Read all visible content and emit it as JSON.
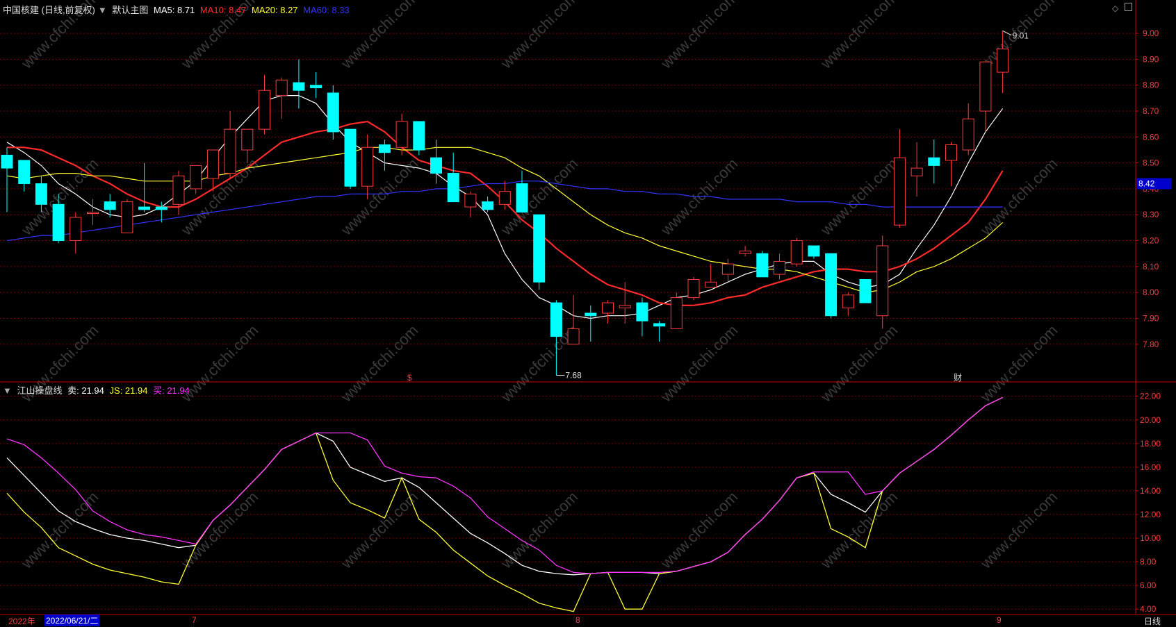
{
  "header_main": {
    "stock": "中国核建 (日线,前复权)",
    "template": "默认主图",
    "ma5": {
      "label": "MA5: 8.71",
      "color": "#ffffff"
    },
    "ma10": {
      "label": "MA10: 8.47",
      "color": "#ff2a2a"
    },
    "ma20": {
      "label": "MA20: 8.27",
      "color": "#ffff33"
    },
    "ma60": {
      "label": "MA60: 8.33",
      "color": "#3333ff"
    }
  },
  "header_sub": {
    "indicator": "江山操盘线",
    "sell": {
      "label": "卖: 21.94",
      "color": "#ffffff"
    },
    "js": {
      "label": "JS: 21.94",
      "color": "#ffff33"
    },
    "buy": {
      "label": "买: 21.94",
      "color": "#ff33ff"
    }
  },
  "watermark": "www.cfchi.com",
  "bottom_bar": {
    "year": "2022年",
    "cursor_date": "2022/06/21/二",
    "months": [
      "7",
      "8",
      "9"
    ],
    "period": "日线"
  },
  "markers": {
    "s": "$",
    "cai": "财",
    "high": "9.01",
    "low": "7.68",
    "current": "8.42"
  },
  "colors": {
    "up": "#ff3b3b",
    "down": "#00ffff",
    "grid": "#7a0000",
    "axis": "#cc0000",
    "bg": "#000000"
  },
  "chart_data": [
    {
      "type": "candlestick",
      "title": "中国核建 (日线,前复权)",
      "y_ticks": [
        "9.00",
        "8.90",
        "8.80",
        "8.70",
        "8.60",
        "8.50",
        "8.40",
        "8.30",
        "8.20",
        "8.10",
        "8.00",
        "7.90",
        "7.80"
      ],
      "ylim": [
        7.66,
        9.07
      ],
      "candles": [
        {
          "o": 8.53,
          "h": 8.56,
          "l": 8.31,
          "c": 8.48
        },
        {
          "o": 8.51,
          "h": 8.51,
          "l": 8.39,
          "c": 8.42
        },
        {
          "o": 8.42,
          "h": 8.45,
          "l": 8.31,
          "c": 8.34
        },
        {
          "o": 8.34,
          "h": 8.38,
          "l": 8.19,
          "c": 8.2
        },
        {
          "o": 8.2,
          "h": 8.31,
          "l": 8.15,
          "c": 8.29
        },
        {
          "o": 8.31,
          "h": 8.36,
          "l": 8.26,
          "c": 8.31
        },
        {
          "o": 8.35,
          "h": 8.38,
          "l": 8.29,
          "c": 8.32
        },
        {
          "o": 8.23,
          "h": 8.36,
          "l": 8.23,
          "c": 8.35
        },
        {
          "o": 8.33,
          "h": 8.5,
          "l": 8.31,
          "c": 8.32
        },
        {
          "o": 8.33,
          "h": 8.35,
          "l": 8.27,
          "c": 8.32
        },
        {
          "o": 8.34,
          "h": 8.47,
          "l": 8.3,
          "c": 8.45
        },
        {
          "o": 8.4,
          "h": 8.49,
          "l": 8.38,
          "c": 8.49
        },
        {
          "o": 8.44,
          "h": 8.55,
          "l": 8.39,
          "c": 8.55
        },
        {
          "o": 8.46,
          "h": 8.7,
          "l": 8.44,
          "c": 8.63
        },
        {
          "o": 8.55,
          "h": 8.62,
          "l": 8.5,
          "c": 8.63
        },
        {
          "o": 8.63,
          "h": 8.84,
          "l": 8.61,
          "c": 8.78
        },
        {
          "o": 8.76,
          "h": 8.83,
          "l": 8.67,
          "c": 8.82
        },
        {
          "o": 8.81,
          "h": 8.9,
          "l": 8.71,
          "c": 8.78
        },
        {
          "o": 8.8,
          "h": 8.85,
          "l": 8.75,
          "c": 8.79
        },
        {
          "o": 8.77,
          "h": 8.8,
          "l": 8.59,
          "c": 8.62
        },
        {
          "o": 8.63,
          "h": 8.63,
          "l": 8.4,
          "c": 8.41
        },
        {
          "o": 8.41,
          "h": 8.61,
          "l": 8.36,
          "c": 8.56
        },
        {
          "o": 8.57,
          "h": 8.59,
          "l": 8.47,
          "c": 8.54
        },
        {
          "o": 8.56,
          "h": 8.69,
          "l": 8.53,
          "c": 8.66
        },
        {
          "o": 8.66,
          "h": 8.66,
          "l": 8.53,
          "c": 8.55
        },
        {
          "o": 8.52,
          "h": 8.59,
          "l": 8.42,
          "c": 8.46
        },
        {
          "o": 8.46,
          "h": 8.54,
          "l": 8.35,
          "c": 8.35
        },
        {
          "o": 8.33,
          "h": 8.39,
          "l": 8.29,
          "c": 8.38
        },
        {
          "o": 8.35,
          "h": 8.37,
          "l": 8.31,
          "c": 8.32
        },
        {
          "o": 8.34,
          "h": 8.43,
          "l": 8.32,
          "c": 8.39
        },
        {
          "o": 8.42,
          "h": 8.47,
          "l": 8.31,
          "c": 8.31
        },
        {
          "o": 8.3,
          "h": 8.3,
          "l": 8.01,
          "c": 8.04
        },
        {
          "o": 7.96,
          "h": 7.97,
          "l": 7.68,
          "c": 7.83
        },
        {
          "o": 7.8,
          "h": 7.99,
          "l": 7.8,
          "c": 7.86
        },
        {
          "o": 7.92,
          "h": 7.95,
          "l": 7.81,
          "c": 7.91
        },
        {
          "o": 7.92,
          "h": 7.97,
          "l": 7.88,
          "c": 7.96
        },
        {
          "o": 7.94,
          "h": 8.04,
          "l": 7.88,
          "c": 7.95
        },
        {
          "o": 7.96,
          "h": 7.98,
          "l": 7.83,
          "c": 7.89
        },
        {
          "o": 7.88,
          "h": 7.89,
          "l": 7.81,
          "c": 7.87
        },
        {
          "o": 7.86,
          "h": 8.0,
          "l": 7.86,
          "c": 7.98
        },
        {
          "o": 7.98,
          "h": 8.06,
          "l": 7.97,
          "c": 8.05
        },
        {
          "o": 8.02,
          "h": 8.11,
          "l": 8.02,
          "c": 8.04
        },
        {
          "o": 8.07,
          "h": 8.13,
          "l": 8.04,
          "c": 8.11
        },
        {
          "o": 8.15,
          "h": 8.18,
          "l": 8.14,
          "c": 8.16
        },
        {
          "o": 8.15,
          "h": 8.16,
          "l": 8.06,
          "c": 8.06
        },
        {
          "o": 8.07,
          "h": 8.15,
          "l": 8.05,
          "c": 8.12
        },
        {
          "o": 8.11,
          "h": 8.21,
          "l": 8.1,
          "c": 8.2
        },
        {
          "o": 8.18,
          "h": 8.18,
          "l": 8.13,
          "c": 8.14
        },
        {
          "o": 8.15,
          "h": 8.15,
          "l": 7.9,
          "c": 7.91
        },
        {
          "o": 7.94,
          "h": 8.0,
          "l": 7.91,
          "c": 7.99
        },
        {
          "o": 8.05,
          "h": 8.05,
          "l": 7.96,
          "c": 7.96
        },
        {
          "o": 7.91,
          "h": 8.22,
          "l": 7.86,
          "c": 8.18
        },
        {
          "o": 8.26,
          "h": 8.63,
          "l": 8.25,
          "c": 8.52
        },
        {
          "o": 8.45,
          "h": 8.58,
          "l": 8.37,
          "c": 8.48
        },
        {
          "o": 8.52,
          "h": 8.59,
          "l": 8.42,
          "c": 8.49
        },
        {
          "o": 8.51,
          "h": 8.58,
          "l": 8.41,
          "c": 8.57
        },
        {
          "o": 8.55,
          "h": 8.73,
          "l": 8.53,
          "c": 8.67
        },
        {
          "o": 8.7,
          "h": 8.89,
          "l": 8.62,
          "c": 8.89
        },
        {
          "o": 8.85,
          "h": 9.01,
          "l": 8.77,
          "c": 8.94
        }
      ],
      "series": [
        {
          "name": "MA5",
          "color": "#ffffff",
          "values": [
            8.58,
            8.54,
            8.49,
            8.42,
            8.38,
            8.33,
            8.3,
            8.29,
            8.3,
            8.33,
            8.38,
            8.43,
            8.52,
            8.6,
            8.67,
            8.74,
            8.76,
            8.76,
            8.73,
            8.65,
            8.58,
            8.54,
            8.5,
            8.49,
            8.48,
            8.46,
            8.41,
            8.37,
            8.3,
            8.15,
            8.05,
            7.98,
            7.95,
            7.91,
            7.9,
            7.91,
            7.91,
            7.92,
            7.95,
            7.98,
            7.99,
            8.01,
            8.04,
            8.07,
            8.09,
            8.11,
            8.12,
            8.12,
            8.07,
            8.04,
            8.02,
            8.03,
            8.07,
            8.17,
            8.26,
            8.37,
            8.5,
            8.62,
            8.71
          ]
        },
        {
          "name": "MA10",
          "color": "#ff2a2a",
          "values": [
            8.56,
            8.56,
            8.55,
            8.52,
            8.49,
            8.45,
            8.42,
            8.38,
            8.35,
            8.33,
            8.33,
            8.36,
            8.4,
            8.44,
            8.48,
            8.53,
            8.58,
            8.6,
            8.62,
            8.63,
            8.65,
            8.66,
            8.62,
            8.56,
            8.51,
            8.49,
            8.47,
            8.46,
            8.41,
            8.35,
            8.28,
            8.23,
            8.17,
            8.12,
            8.07,
            8.03,
            8.01,
            7.99,
            7.96,
            7.95,
            7.95,
            7.96,
            7.98,
            7.99,
            8.02,
            8.04,
            8.06,
            8.08,
            8.09,
            8.09,
            8.08,
            8.08,
            8.1,
            8.13,
            8.17,
            8.22,
            8.27,
            8.36,
            8.47
          ]
        },
        {
          "name": "MA20",
          "color": "#ffff33",
          "values": [
            8.45,
            8.44,
            8.45,
            8.46,
            8.46,
            8.45,
            8.45,
            8.44,
            8.43,
            8.43,
            8.43,
            8.43,
            8.45,
            8.46,
            8.48,
            8.49,
            8.5,
            8.51,
            8.52,
            8.53,
            8.54,
            8.56,
            8.56,
            8.55,
            8.55,
            8.56,
            8.56,
            8.56,
            8.54,
            8.52,
            8.48,
            8.45,
            8.4,
            8.35,
            8.3,
            8.26,
            8.23,
            8.21,
            8.18,
            8.16,
            8.14,
            8.12,
            8.11,
            8.1,
            8.09,
            8.09,
            8.08,
            8.06,
            8.04,
            8.02,
            8.0,
            8.01,
            8.04,
            8.08,
            8.1,
            8.13,
            8.17,
            8.21,
            8.27
          ]
        },
        {
          "name": "MA60",
          "color": "#3333ff",
          "values": [
            8.2,
            8.21,
            8.22,
            8.22,
            8.23,
            8.24,
            8.25,
            8.26,
            8.27,
            8.28,
            8.29,
            8.3,
            8.31,
            8.32,
            8.33,
            8.34,
            8.35,
            8.36,
            8.37,
            8.37,
            8.38,
            8.38,
            8.38,
            8.39,
            8.39,
            8.4,
            8.4,
            8.41,
            8.42,
            8.42,
            8.43,
            8.43,
            8.42,
            8.41,
            8.4,
            8.4,
            8.39,
            8.39,
            8.38,
            8.38,
            8.37,
            8.37,
            8.36,
            8.36,
            8.36,
            8.36,
            8.35,
            8.35,
            8.35,
            8.34,
            8.34,
            8.33,
            8.33,
            8.33,
            8.33,
            8.33,
            8.33,
            8.33,
            8.33
          ]
        }
      ]
    },
    {
      "type": "line",
      "title": "江山操盘线",
      "y_ticks": [
        "22.00",
        "20.00",
        "18.00",
        "16.00",
        "14.00",
        "12.00",
        "10.00",
        "8.00",
        "6.00",
        "4.00"
      ],
      "ylim": [
        3.6,
        23.1
      ],
      "series": [
        {
          "name": "卖",
          "color": "#ffffff",
          "values": [
            16.8,
            15.3,
            13.8,
            12.3,
            11.4,
            10.8,
            10.3,
            10.0,
            9.8,
            9.5,
            9.2,
            9.4,
            11.5,
            12.8,
            14.3,
            15.8,
            17.5,
            18.2,
            18.9,
            18.2,
            16.0,
            15.4,
            14.8,
            15.1,
            14.3,
            13.0,
            11.7,
            10.4,
            9.6,
            8.7,
            7.7,
            7.2,
            7.0,
            6.9,
            7.0,
            7.1,
            7.1,
            7.1,
            7.0,
            7.2,
            7.6,
            8.0,
            8.8,
            10.3,
            11.6,
            13.2,
            15.1,
            15.5,
            13.7,
            13.0,
            12.2,
            14.0,
            15.5,
            16.5,
            17.5,
            18.7,
            20.0,
            21.2,
            21.9
          ]
        },
        {
          "name": "JS",
          "color": "#ffff33",
          "values": [
            13.8,
            12.2,
            10.9,
            9.2,
            8.5,
            7.8,
            7.3,
            7.0,
            6.7,
            6.3,
            6.1,
            9.4,
            11.5,
            12.8,
            14.3,
            15.8,
            17.5,
            18.2,
            18.9,
            14.9,
            13.0,
            12.4,
            11.7,
            15.1,
            11.6,
            10.5,
            9.0,
            7.9,
            6.8,
            6.0,
            5.3,
            4.5,
            4.1,
            3.8,
            7.0,
            7.1,
            4.0,
            4.0,
            7.0,
            7.2,
            7.6,
            8.0,
            8.8,
            10.3,
            11.6,
            13.2,
            15.1,
            15.5,
            10.8,
            10.1,
            9.2,
            14.0,
            15.5,
            16.5,
            17.5,
            18.7,
            20.0,
            21.2,
            21.9
          ]
        },
        {
          "name": "买",
          "color": "#ff33ff",
          "values": [
            18.4,
            17.9,
            16.8,
            15.5,
            14.1,
            12.3,
            11.4,
            10.7,
            10.3,
            10.1,
            9.8,
            9.5,
            11.5,
            12.8,
            14.3,
            15.8,
            17.5,
            18.2,
            18.9,
            18.9,
            18.9,
            18.3,
            16.1,
            15.5,
            15.2,
            15.1,
            14.4,
            13.4,
            11.8,
            10.8,
            9.8,
            9.0,
            7.7,
            7.1,
            7.0,
            7.1,
            7.1,
            7.1,
            7.1,
            7.2,
            7.6,
            8.0,
            8.8,
            10.3,
            11.6,
            13.2,
            15.1,
            15.6,
            15.6,
            15.6,
            13.7,
            14.0,
            15.5,
            16.5,
            17.5,
            18.7,
            20.0,
            21.2,
            21.9
          ]
        }
      ]
    }
  ]
}
